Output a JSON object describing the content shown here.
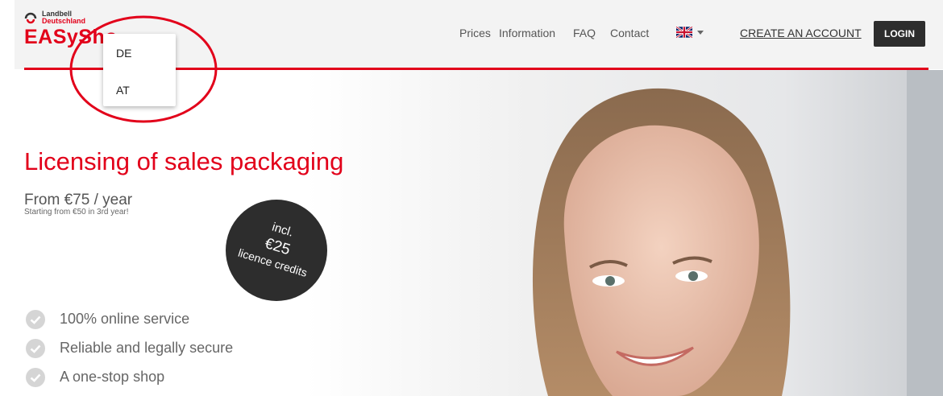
{
  "logo": {
    "line1": "Landbell",
    "line2": "Deutschland",
    "text": "EASySho"
  },
  "nav": {
    "prices": "Prices",
    "information": "Information",
    "faq": "FAQ",
    "contact": "Contact"
  },
  "language": {
    "icon": "uk-flag-icon"
  },
  "create_account": "CREATE AN ACCOUNT",
  "login": "LOGIN",
  "country_dropdown": {
    "options": [
      "DE",
      "AT"
    ]
  },
  "hero": {
    "title": "Licensing of sales packaging",
    "price": "From €75 / year",
    "price_note": "Starting from €50 in 3rd year!",
    "badge": {
      "line1": "incl.",
      "line2": "€25",
      "line3": "licence credits"
    },
    "features": [
      "100% online service",
      "Reliable and legally secure",
      "A one-stop shop"
    ]
  },
  "colors": {
    "brand": "#e2001a",
    "dark": "#2d2d2d",
    "header_bg": "#f3f3f3"
  }
}
